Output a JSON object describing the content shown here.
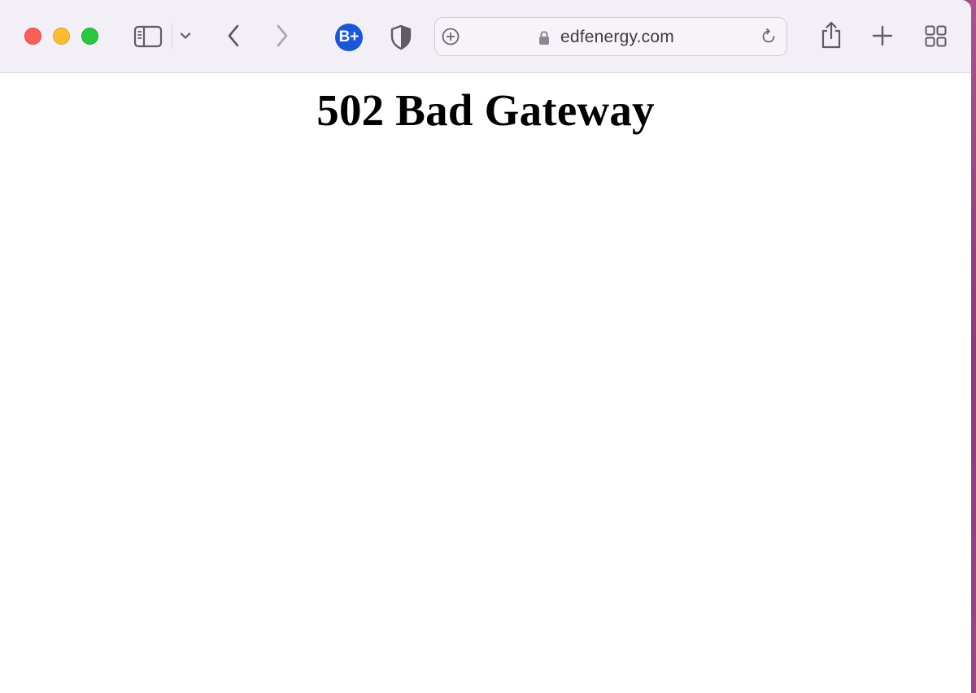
{
  "browser": {
    "address_bar": {
      "url": "edfenergy.com"
    },
    "extension": {
      "label": "B+",
      "color": "#1a56db"
    },
    "toolbar_icons": [
      "close-window-icon",
      "minimize-window-icon",
      "zoom-window-icon",
      "sidebar-icon",
      "chevron-down-icon",
      "back-arrow-icon",
      "forward-arrow-icon",
      "privacy-shield-icon",
      "add-plus-circle-icon",
      "lock-icon",
      "reload-icon",
      "share-icon",
      "new-tab-plus-icon",
      "tab-overview-grid-icon"
    ]
  },
  "page": {
    "heading": "502 Bad Gateway"
  }
}
